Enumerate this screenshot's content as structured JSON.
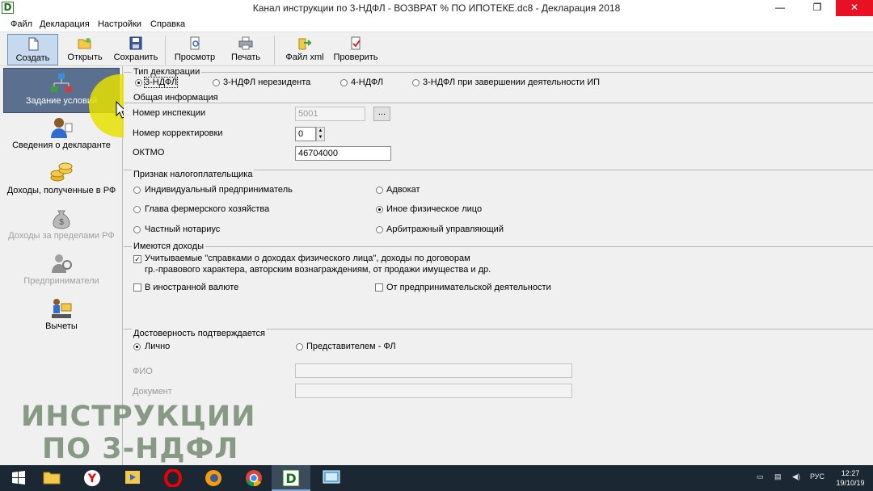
{
  "window": {
    "title": "Канал инструкции по 3-НДФЛ -  ВОЗВРАТ % ПО ИПОТЕКЕ.dc8 - Декларация 2018",
    "minimize": "—",
    "maximize": "❐",
    "close": "✕",
    "app_logo": "D"
  },
  "menu": [
    "Файл",
    "Декларация",
    "Настройки",
    "Справка"
  ],
  "toolbar": {
    "create": "Создать",
    "open": "Открыть",
    "save": "Сохранить",
    "preview": "Просмотр",
    "print": "Печать",
    "xml": "Файл xml",
    "check": "Проверить"
  },
  "sidebar": [
    {
      "label": "Задание условий",
      "icon": "conditions-icon",
      "state": "active"
    },
    {
      "label": "Сведения о декларанте",
      "icon": "person-icon",
      "state": "normal"
    },
    {
      "label": "Доходы, полученные в РФ",
      "icon": "coins-icon",
      "state": "normal"
    },
    {
      "label": "Доходы за пределами РФ",
      "icon": "money-bag-icon",
      "state": "disabled"
    },
    {
      "label": "Предприниматели",
      "icon": "entrepreneur-icon",
      "state": "disabled"
    },
    {
      "label": "Вычеты",
      "icon": "deductions-icon",
      "state": "normal"
    }
  ],
  "declaration_type": {
    "title": "Тип декларации",
    "options": [
      "3-НДФЛ",
      "3-НДФЛ нерезидента",
      "4-НДФЛ",
      "3-НДФЛ при завершении деятельности ИП"
    ],
    "selected": "3-НДФЛ"
  },
  "general_info": {
    "title": "Общая информация",
    "inspection_label": "Номер инспекции",
    "inspection_value": "5001",
    "browse_label": "...",
    "correction_label": "Номер корректировки",
    "correction_value": "0",
    "oktmo_label": "ОКТМО",
    "oktmo_value": "46704000"
  },
  "taxpayer": {
    "title": "Признак налогоплательщика",
    "options": [
      "Индивидуальный предприниматель",
      "Адвокат",
      "Глава фермерского хозяйства",
      "Иное физическое лицо",
      "Частный нотариус",
      "Арбитражный управляющий"
    ],
    "selected": "Иное физическое лицо"
  },
  "incomes": {
    "title": "Имеются доходы",
    "certified_line1": "Учитываемые \"справками о доходах физического лица\", доходы по договорам",
    "certified_line2": "гр.-правового характера, авторским вознаграждениям, от продажи имущества и др.",
    "certified_checked": true,
    "foreign_currency": "В иностранной валюте",
    "foreign_checked": false,
    "business": "От предпринимательской деятельности",
    "business_checked": false
  },
  "reliability": {
    "title": "Достоверность подтверждается",
    "personal": "Лично",
    "representative": "Представителем - ФЛ",
    "selected": "Лично",
    "fio_label": "ФИО",
    "document_label": "Документ"
  },
  "watermark": {
    "line1": "ИНСТРУКЦИИ",
    "line2": "ПО 3-НДФЛ"
  },
  "taskbar": {
    "lang": "РУС",
    "time": "12:27",
    "date": "19/10/19"
  },
  "colors": {
    "active_sidebar": "#5b6f8e",
    "cursor_highlight": "#e6e100",
    "taskbar": "#1b2733"
  }
}
